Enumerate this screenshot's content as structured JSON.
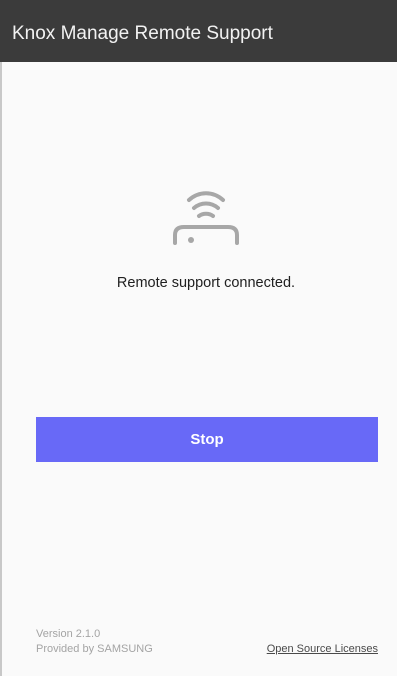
{
  "app_bar": {
    "title": "Knox Manage Remote Support",
    "background_color": "#3b3b3b"
  },
  "status": {
    "icon": "remote-connection-icon",
    "message": "Remote support connected."
  },
  "actions": {
    "stop_label": "Stop",
    "stop_color": "#6869f7"
  },
  "footer": {
    "version": "Version 2.1.0",
    "provider": "Provided by SAMSUNG",
    "licenses_link": "Open Source Licenses"
  }
}
